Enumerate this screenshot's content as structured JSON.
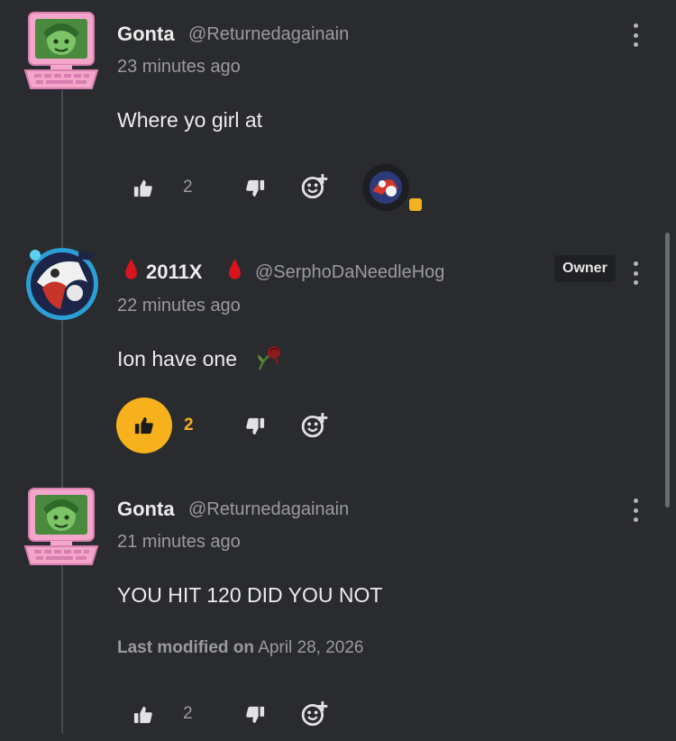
{
  "comments": [
    {
      "author": "Gonta",
      "handle": "@Returnedagainain",
      "time": "23 minutes ago",
      "text": "Where yo girl at",
      "likes": "2"
    },
    {
      "author": "2011X",
      "handle": "@SerphoDaNeedleHog",
      "time": "22 minutes ago",
      "text": "Ion have one",
      "likes": "2",
      "badge": "Owner"
    },
    {
      "author": "Gonta",
      "handle": "@Returnedagainain",
      "time": "21 minutes ago",
      "text": "YOU HIT 120 DID YOU NOT",
      "modified_label": "Last modified on",
      "modified_date": "April 28, 2026",
      "likes": "2"
    }
  ],
  "icons": {
    "like": "thumbs-up-icon",
    "dislike": "thumbs-down-icon",
    "react": "add-reaction-icon",
    "more": "kebab-menu-icon",
    "drop": "blood-drop-icon",
    "rose": "wilted-rose-emoji"
  },
  "colors": {
    "background": "#2a2b2f",
    "accent": "#f6b11c",
    "muted": "#9a9b9f",
    "text": "#ececec",
    "blood": "#d8141c"
  }
}
